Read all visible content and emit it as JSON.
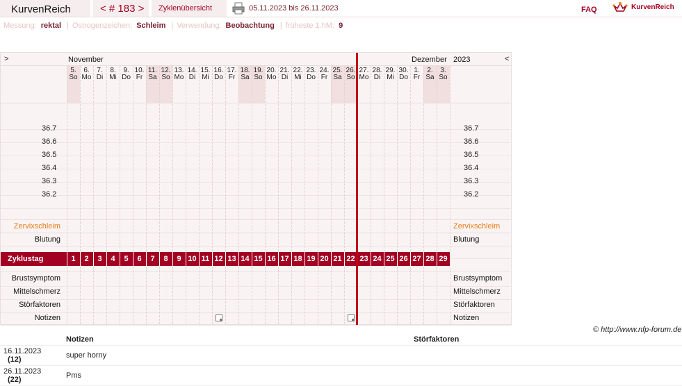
{
  "header": {
    "title": "KurvenReich",
    "cycle": "< # 183 >",
    "overview": "Zyklenübersicht",
    "range": "05.11.2023 bis 26.11.2023",
    "faq": "FAQ",
    "brand": "KurvenReich"
  },
  "meta": [
    {
      "label": "Messung:",
      "value": "rektal"
    },
    {
      "label": "Östrogenzeichen:",
      "value": "Schleim"
    },
    {
      "label": "Verwendung:",
      "value": "Beobachtung"
    },
    {
      "label": "früheste 1.hM:",
      "value": "9"
    }
  ],
  "chart": {
    "nav_prev": ">",
    "nav_next": "<",
    "month1": "November",
    "month2": "Dezember",
    "year": "2023",
    "days": [
      {
        "d": "5.",
        "w": "So",
        "we": true
      },
      {
        "d": "6.",
        "w": "Mo"
      },
      {
        "d": "7.",
        "w": "Di"
      },
      {
        "d": "8.",
        "w": "Mi"
      },
      {
        "d": "9.",
        "w": "Do"
      },
      {
        "d": "10.",
        "w": "Fr"
      },
      {
        "d": "11.",
        "w": "Sa",
        "we": true
      },
      {
        "d": "12.",
        "w": "So",
        "we": true
      },
      {
        "d": "13.",
        "w": "Mo"
      },
      {
        "d": "14.",
        "w": "Di"
      },
      {
        "d": "15.",
        "w": "Mi"
      },
      {
        "d": "16.",
        "w": "Do"
      },
      {
        "d": "17.",
        "w": "Fr"
      },
      {
        "d": "18.",
        "w": "Sa",
        "we": true
      },
      {
        "d": "19.",
        "w": "So",
        "we": true
      },
      {
        "d": "20.",
        "w": "Mo"
      },
      {
        "d": "21.",
        "w": "Di"
      },
      {
        "d": "22.",
        "w": "Mi"
      },
      {
        "d": "23.",
        "w": "Do"
      },
      {
        "d": "24.",
        "w": "Fr"
      },
      {
        "d": "25.",
        "w": "Sa",
        "we": true
      },
      {
        "d": "26.",
        "w": "So",
        "we": true
      },
      {
        "d": "27.",
        "w": "Mo"
      },
      {
        "d": "28.",
        "w": "Di"
      },
      {
        "d": "29.",
        "w": "Mi"
      },
      {
        "d": "30.",
        "w": "Do"
      },
      {
        "d": "1.",
        "w": "Fr"
      },
      {
        "d": "2.",
        "w": "Sa",
        "we": true
      },
      {
        "d": "3.",
        "w": "So",
        "we": true
      }
    ],
    "temps": [
      "36.7",
      "36.6",
      "36.5",
      "36.4",
      "36.3",
      "36.2"
    ],
    "row_labels": {
      "cervix": "Zervixschleim",
      "bleeding": "Blutung",
      "cycle_day": "Zyklustag",
      "breast": "Brustsymptom",
      "mittel": "Mittelschmerz",
      "stoer": "Störfaktoren",
      "notes": "Notizen"
    },
    "cycle_days": [
      "1",
      "2",
      "3",
      "4",
      "5",
      "6",
      "7",
      "8",
      "9",
      "10",
      "11",
      "12",
      "13",
      "14",
      "15",
      "16",
      "17",
      "18",
      "19",
      "20",
      "21",
      "22",
      "23",
      "24",
      "25",
      "26",
      "27",
      "28",
      "29"
    ],
    "note_days": [
      11,
      21
    ],
    "today_index": 22
  },
  "copyright": "© http://www.nfp-forum.de",
  "notes_table": {
    "headers": [
      "Notizen",
      "Störfaktoren"
    ],
    "rows": [
      {
        "date": "16.11.2023",
        "day": "(12)",
        "note": "super horny"
      },
      {
        "date": "26.11.2023",
        "day": "(22)",
        "note": "Pms"
      }
    ]
  }
}
